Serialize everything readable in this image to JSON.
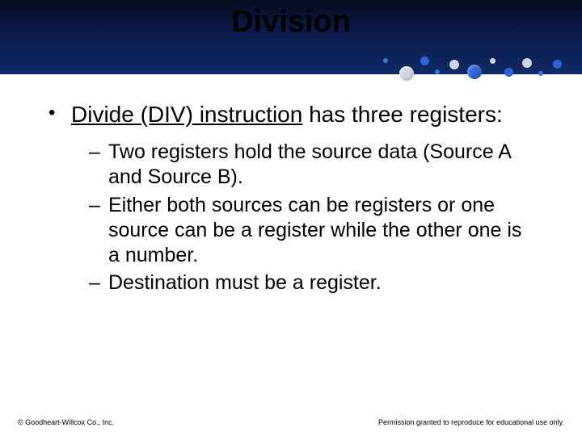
{
  "title": "Division",
  "main": {
    "underlined": "Divide (DIV) instruction",
    "rest": " has three registers:"
  },
  "subs": [
    "Two registers hold the source data (Source A and Source B).",
    "Either both sources can be registers or one source can be a register while the other one is a number.",
    "Destination must be a register."
  ],
  "footer": {
    "left": "© Goodheart-Willcox Co., Inc.",
    "right": "Permission granted to reproduce for educational use only."
  }
}
